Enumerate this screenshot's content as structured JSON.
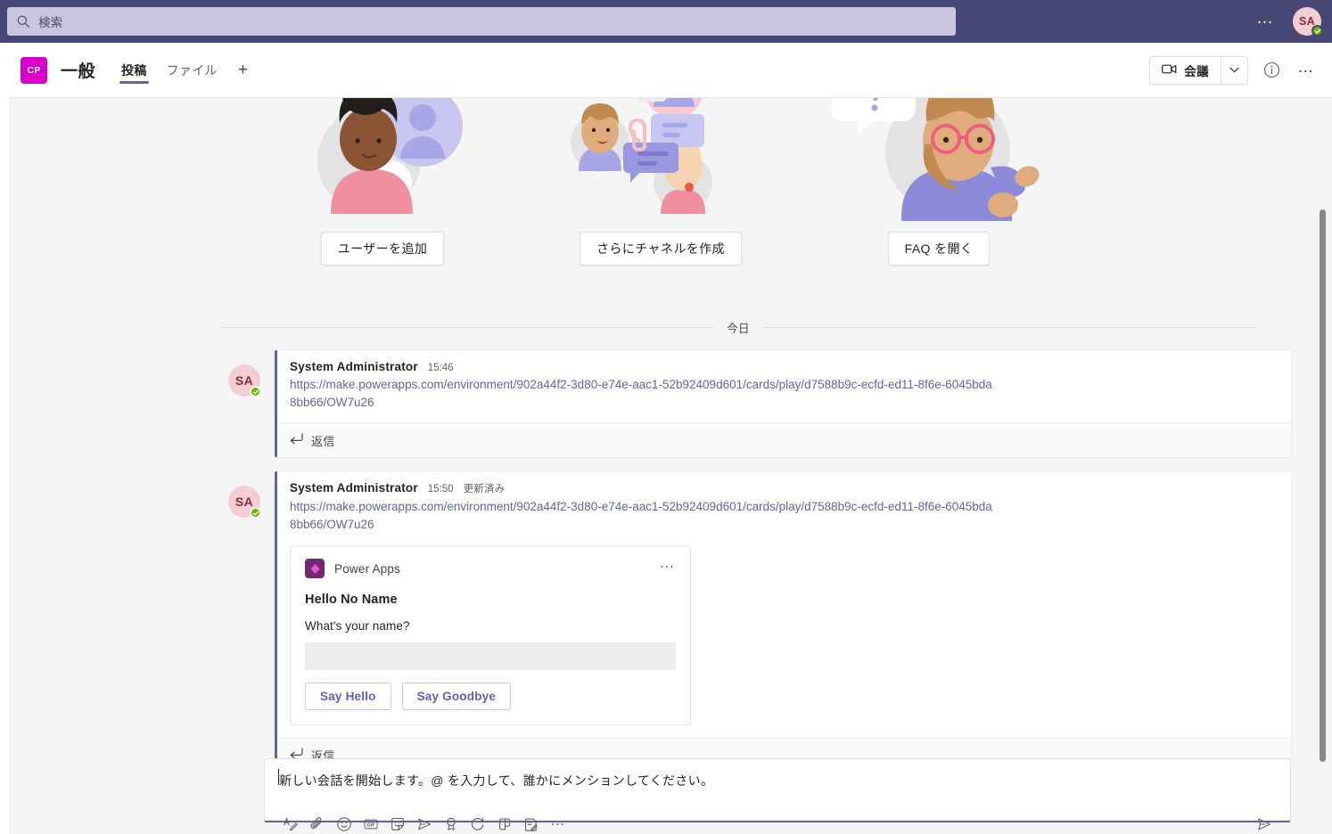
{
  "topbar": {
    "search": {
      "placeholder": "検索",
      "value": "",
      "icon": "search-icon"
    },
    "overflow_label": "…",
    "user": {
      "initials": "SA",
      "presence": "available"
    }
  },
  "channel_header": {
    "team_initials": "CP",
    "channel_name": "一般",
    "tabs": [
      {
        "label": "投稿",
        "active": true
      },
      {
        "label": "ファイル",
        "active": false
      }
    ],
    "add_tab_label": "+",
    "meet_label": "会議",
    "meet_caret": "⌄",
    "info_label": "i",
    "more_label": "…"
  },
  "hero": {
    "cards": [
      {
        "art": "add-people-illustration",
        "button": "ユーザーを追加"
      },
      {
        "art": "create-channels-illustration",
        "button": "さらにチャネルを作成"
      },
      {
        "art": "open-faq-illustration",
        "button": "FAQ を開く"
      }
    ]
  },
  "conversation": {
    "date_divider": "今日",
    "messages": [
      {
        "avatar_initials": "SA",
        "author": "System Administrator",
        "time": "15:46",
        "edited": "",
        "link": "https://make.powerapps.com/environment/902a44f2-3d80-e74e-aac1-52b92409d601/cards/play/d7588b9c-ecfd-ed11-8f6e-6045bda8bb66/OW7u26",
        "reply_label": "返信",
        "has_card": false
      },
      {
        "avatar_initials": "SA",
        "author": "System Administrator",
        "time": "15:50",
        "edited": "更新済み",
        "link": "https://make.powerapps.com/environment/902a44f2-3d80-e74e-aac1-52b92409d601/cards/play/d7588b9c-ecfd-ed11-8f6e-6045bda8bb66/OW7u26",
        "reply_label": "返信",
        "has_card": true,
        "card": {
          "app_name": "Power Apps",
          "app_icon": "power-apps-icon",
          "more_label": "…",
          "title": "Hello No Name",
          "question": "What's your name?",
          "input_value": "",
          "input_placeholder": "",
          "buttons": [
            {
              "label": "Say Hello"
            },
            {
              "label": "Say Goodbye"
            }
          ]
        }
      }
    ]
  },
  "compose": {
    "placeholder": "新しい会話を開始します。@ を入力して、誰かにメンションしてください。",
    "value": "",
    "tools": [
      {
        "name": "format-icon"
      },
      {
        "name": "attach-icon"
      },
      {
        "name": "emoji-icon"
      },
      {
        "name": "gif-icon"
      },
      {
        "name": "sticker-icon"
      },
      {
        "name": "send-later-icon"
      },
      {
        "name": "praise-icon"
      },
      {
        "name": "loop-icon"
      },
      {
        "name": "approvals-icon"
      },
      {
        "name": "forms-icon"
      }
    ],
    "more_label": "…",
    "send_label": "send-icon"
  },
  "colors": {
    "brand_purple": "#6264a7",
    "topbar_purple": "#464775",
    "team_magenta": "#d900cd",
    "presence_green": "#6bb700",
    "power_apps_purple": "#742774",
    "content_bg": "#f5f5f5"
  }
}
